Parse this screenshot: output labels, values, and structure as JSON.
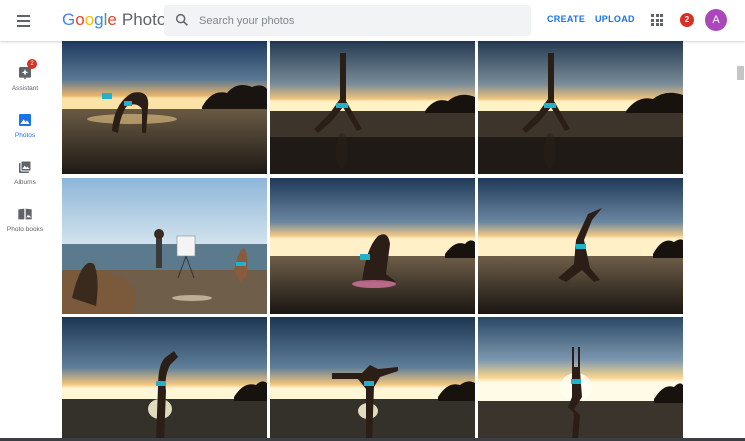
{
  "header": {
    "logo_google": [
      "G",
      "o",
      "o",
      "g",
      "l",
      "e"
    ],
    "product": "Photos",
    "search_placeholder": "Search your photos",
    "create_label": "CREATE",
    "upload_label": "UPLOAD",
    "notification_count": "2",
    "avatar_letter": "A",
    "avatar_color": "#ab47bc"
  },
  "sidebar": {
    "items": [
      {
        "label": "Assistant",
        "icon": "assistant-icon",
        "badge": "2",
        "active": false
      },
      {
        "label": "Photos",
        "icon": "photos-icon",
        "active": true
      },
      {
        "label": "Albums",
        "icon": "albums-icon",
        "active": false
      },
      {
        "label": "Photo books",
        "icon": "photo-books-icon",
        "active": false
      }
    ]
  },
  "colors": {
    "accent": "#1a73e8",
    "badge": "#d93025"
  },
  "grid": {
    "photos": [
      {
        "scene": "backbend",
        "sky": "dusk"
      },
      {
        "scene": "downward-dog-leg-up",
        "sky": "dusk"
      },
      {
        "scene": "downward-dog-leg-up",
        "sky": "dusk"
      },
      {
        "scene": "photoshoot-setup",
        "sky": "day"
      },
      {
        "scene": "kneeling-backbend",
        "sky": "dusk"
      },
      {
        "scene": "lunge-arms-up",
        "sky": "dusk"
      },
      {
        "scene": "dancer-pose",
        "sky": "dusk"
      },
      {
        "scene": "dancer-pose-wide",
        "sky": "dusk"
      },
      {
        "scene": "tree-pose-arms-up",
        "sky": "dusk"
      }
    ]
  }
}
